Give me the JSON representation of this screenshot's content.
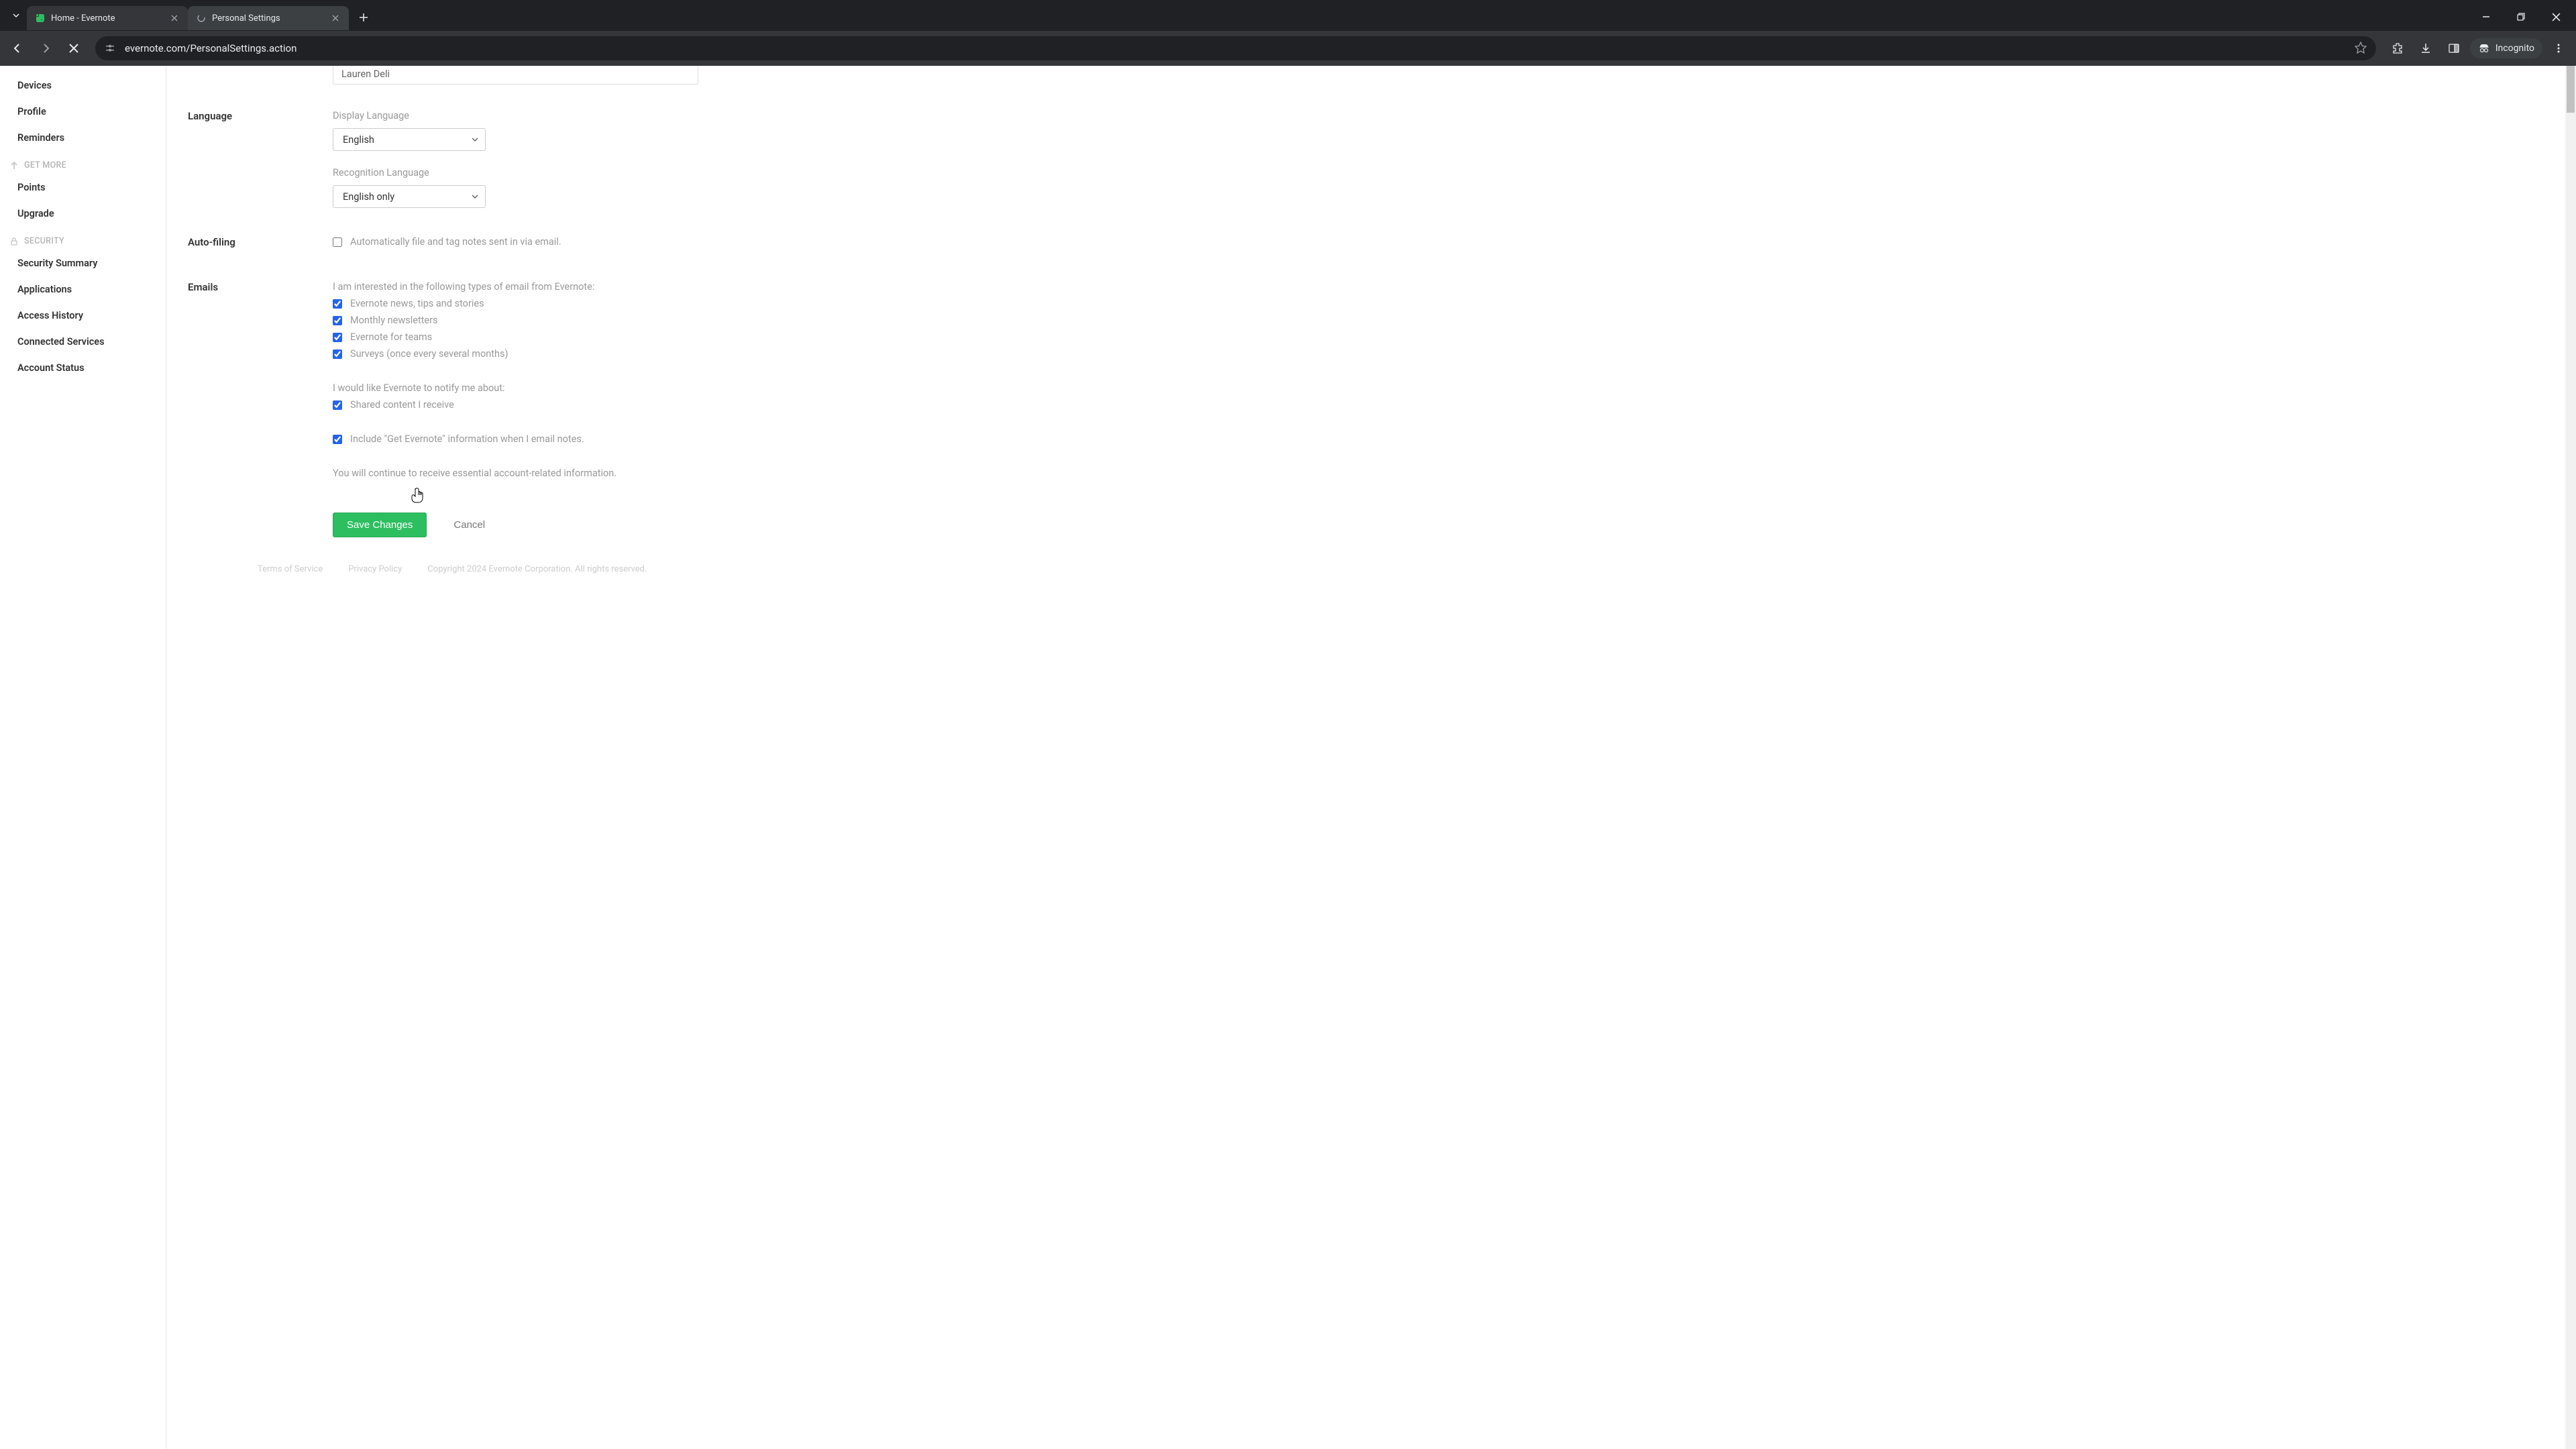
{
  "browser": {
    "tabs": [
      {
        "title": "Home - Evernote",
        "active": false
      },
      {
        "title": "Personal Settings",
        "active": true
      }
    ],
    "url": "evernote.com/PersonalSettings.action",
    "incognito": "Incognito"
  },
  "sidebar": {
    "items_top": [
      "Devices",
      "Profile",
      "Reminders"
    ],
    "header1": "GET MORE",
    "items_mid": [
      "Points",
      "Upgrade"
    ],
    "header2": "SECURITY",
    "items_sec": [
      "Security Summary",
      "Applications",
      "Access History",
      "Connected Services",
      "Account Status"
    ]
  },
  "name": "Lauren Deli",
  "language": {
    "section": "Language",
    "display_label": "Display Language",
    "display_value": "English",
    "recognition_label": "Recognition Language",
    "recognition_value": "English only"
  },
  "autofiling": {
    "section": "Auto-filing",
    "label": "Automatically file and tag notes sent in via email."
  },
  "emails": {
    "section": "Emails",
    "intro": "I am interested in the following types of email from Evernote:",
    "opts": [
      "Evernote news, tips and stories",
      "Monthly newsletters",
      "Evernote for teams",
      "Surveys (once every several months)"
    ],
    "notify_intro": "I would like Evernote to notify me about:",
    "notify_opt": "Shared content I receive",
    "include": "Include \"Get Evernote\" information when I email notes.",
    "essential": "You will continue to receive essential account-related information."
  },
  "buttons": {
    "save": "Save Changes",
    "cancel": "Cancel"
  },
  "footer": {
    "terms": "Terms of Service",
    "privacy": "Privacy Policy",
    "copyright": "Copyright 2024 Evernote Corporation. All rights reserved."
  }
}
